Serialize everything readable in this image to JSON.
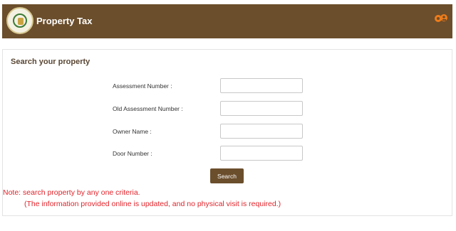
{
  "header": {
    "title": "Property Tax"
  },
  "brand": {
    "colors": {
      "primary": "#6b4e2c",
      "note": "#e0242b",
      "logo": "#ef7c1a"
    }
  },
  "search": {
    "title": "Search your property",
    "fields": [
      {
        "label": "Assessment Number :",
        "value": ""
      },
      {
        "label": "Old Assessment Number :",
        "value": ""
      },
      {
        "label": "Owner Name :",
        "value": ""
      },
      {
        "label": "Door Number :",
        "value": ""
      }
    ],
    "button_label": "Search",
    "note_line1": "Note: search property by any one criteria.",
    "note_line2": "(The information provided online is updated, and no physical visit is required.)"
  }
}
